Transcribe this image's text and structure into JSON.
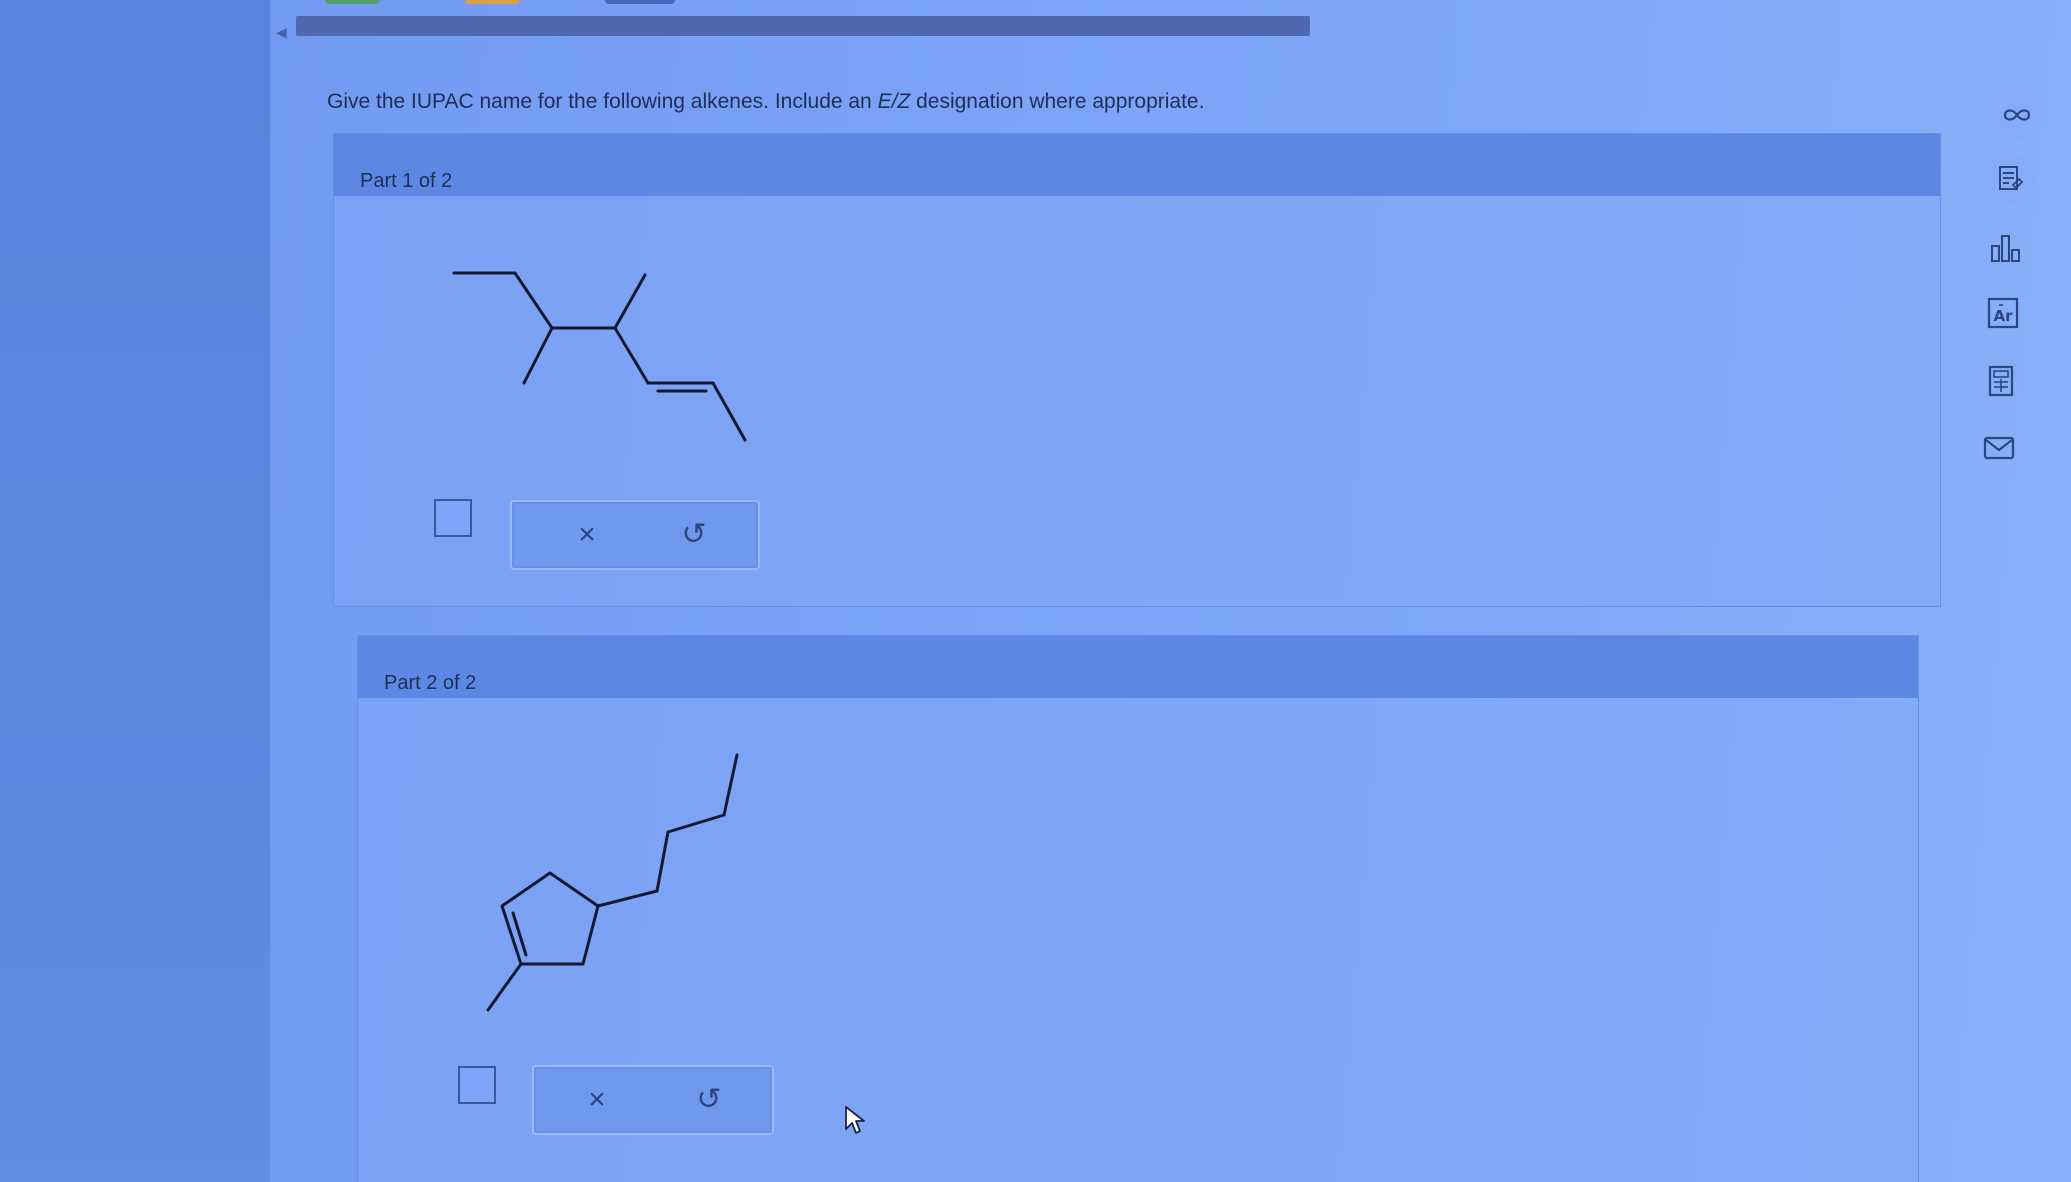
{
  "question": {
    "prefix": "Give the IUPAC name for the following alkenes. Include an ",
    "ez": "E/Z",
    "suffix": " designation where appropriate."
  },
  "parts": [
    {
      "title": "Part 1 of 2",
      "answer": {
        "value": "",
        "clear_symbol": "×",
        "undo_symbol": "↺"
      }
    },
    {
      "title": "Part 2 of 2",
      "answer": {
        "value": "",
        "clear_symbol": "×",
        "undo_symbol": "↺"
      }
    }
  ],
  "toolbar": {
    "icons": [
      "infinity-icon",
      "notes-icon",
      "bar-chart-icon",
      "periodic-table-icon",
      "calculator-icon",
      "mail-icon"
    ]
  },
  "colors": {
    "accent": "#5d87e2",
    "text": "#1f2e57",
    "bond": "#121a33"
  }
}
